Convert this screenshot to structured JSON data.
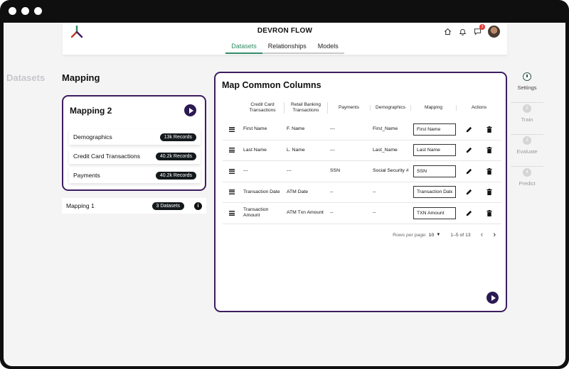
{
  "app": {
    "title": "DEVRON FLOW"
  },
  "top_icons": {
    "notification_count": "3"
  },
  "tabs": [
    {
      "label": "Datasets",
      "active": true
    },
    {
      "label": "Relationships",
      "active": false
    },
    {
      "label": "Models",
      "active": false
    }
  ],
  "left": {
    "ghost_title": "Datasets",
    "section_title": "Mapping",
    "active_mapping": {
      "title": "Mapping 2",
      "datasets": [
        {
          "label": "Demographics",
          "records": "13k Records"
        },
        {
          "label": "Credit Card Transactions",
          "records": "40.2k Records"
        },
        {
          "label": "Payments",
          "records": "40.2k Records"
        }
      ]
    },
    "other_mapping": {
      "label": "Mapping 1",
      "count": "3 Datasets"
    }
  },
  "panel": {
    "title": "Map Common Columns",
    "columns": [
      "Credit Card Transactions",
      "Retail Banking Transactions",
      "Payments",
      "Demographics",
      "Mapping",
      "Actions"
    ],
    "rows": [
      {
        "c1": "First Name",
        "c2": "F. Name",
        "c3": "---",
        "c4": "First_Name",
        "mapping": "First Name"
      },
      {
        "c1": "Last Name",
        "c2": "L. Name",
        "c3": "---",
        "c4": "Last_Name",
        "mapping": "Last Name"
      },
      {
        "c1": "---",
        "c2": "---",
        "c3": "SSN",
        "c4": "Social Security #",
        "mapping": "SSN"
      },
      {
        "c1": "Transaction Date",
        "c2": "ATM Date",
        "c3": "--",
        "c4": "--",
        "mapping": "Transaction Date"
      },
      {
        "c1": "Transaction Amount",
        "c2": "ATM Txn Amount",
        "c3": "--",
        "c4": "--",
        "mapping": "TXN Amount"
      }
    ],
    "pagination": {
      "rows_per_page_label": "Rows per page:",
      "rows_per_page": "10",
      "range": "1–5 of 13"
    }
  },
  "stepper": [
    {
      "num": "",
      "label": "Settings",
      "active": true
    },
    {
      "num": "2",
      "label": "Train",
      "active": false
    },
    {
      "num": "3",
      "label": "Evaluate",
      "active": false
    },
    {
      "num": "4",
      "label": "Predict",
      "active": false
    }
  ],
  "colors": {
    "accent_green": "#2f8c66",
    "border_purple": "#3d1d5f",
    "play_button": "#2c1a52"
  },
  "icons": [
    "logo-icon",
    "home-icon",
    "bell-icon",
    "chat-icon",
    "drag-handle-icon",
    "edit-icon",
    "delete-icon",
    "info-icon",
    "play-icon",
    "dropdown-icon",
    "chevron-left-icon",
    "chevron-right-icon"
  ]
}
